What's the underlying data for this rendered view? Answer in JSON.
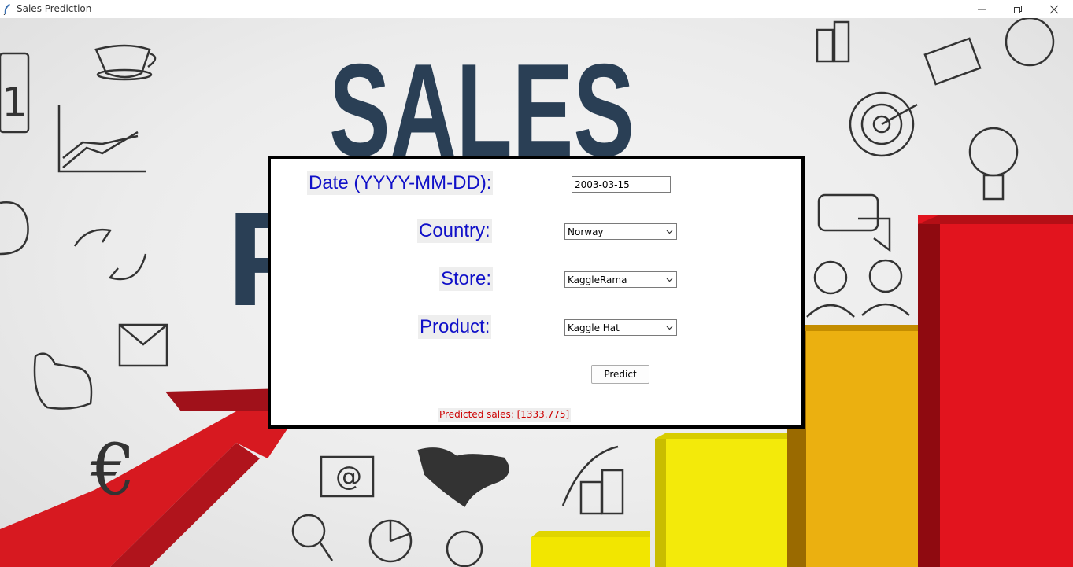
{
  "window": {
    "title": "Sales Prediction",
    "minimize_icon": "minimize-icon",
    "restore_icon": "restore-icon",
    "close_icon": "close-icon"
  },
  "background": {
    "headline": "SALES",
    "partial_letter": "P"
  },
  "form": {
    "date_label": "Date (YYYY-MM-DD):",
    "date_value": "2003-03-15",
    "country_label": "Country:",
    "country_value": "Norway",
    "store_label": "Store:",
    "store_value": "KaggleRama",
    "product_label": "Product:",
    "product_value": "Kaggle Hat",
    "predict_label": "Predict",
    "result_text": "Predicted sales: [1333.775]"
  },
  "colors": {
    "label_text": "#1010c8",
    "result_text": "#cc0000",
    "headline": "#2a3f55"
  }
}
